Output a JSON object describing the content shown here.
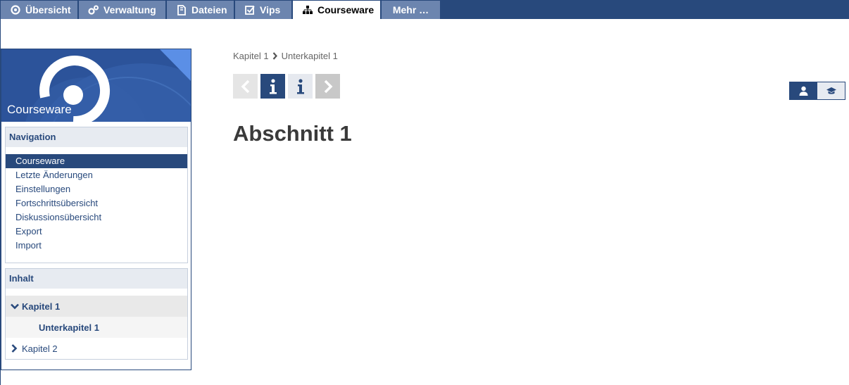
{
  "tabs": [
    {
      "label": "Übersicht",
      "icon": "info-circle-icon"
    },
    {
      "label": "Verwaltung",
      "icon": "admin-gears-icon"
    },
    {
      "label": "Dateien",
      "icon": "files-icon"
    },
    {
      "label": "Vips",
      "icon": "checkbox-icon"
    },
    {
      "label": "Courseware",
      "icon": "hierarchy-icon",
      "active": true
    },
    {
      "label": "Mehr …"
    }
  ],
  "sidebar": {
    "title": "Courseware",
    "navigation": {
      "heading": "Navigation",
      "items": [
        {
          "label": "Courseware",
          "active": true
        },
        {
          "label": "Letzte Änderungen"
        },
        {
          "label": "Einstellungen"
        },
        {
          "label": "Fortschrittsübersicht"
        },
        {
          "label": "Diskussionsübersicht"
        },
        {
          "label": "Export"
        },
        {
          "label": "Import"
        }
      ]
    },
    "content": {
      "heading": "Inhalt",
      "chapter1": "Kapitel 1",
      "subchapter1": "Unterkapitel 1",
      "chapter2": "Kapitel 2"
    }
  },
  "main": {
    "breadcrumb": {
      "item1": "Kapitel 1",
      "item2": "Unterkapitel 1"
    },
    "section_title": "Abschnitt 1"
  },
  "colors": {
    "brand": "#28497c",
    "tab_inactive": "#6c85af",
    "header_bg": "#2f5aa0"
  }
}
